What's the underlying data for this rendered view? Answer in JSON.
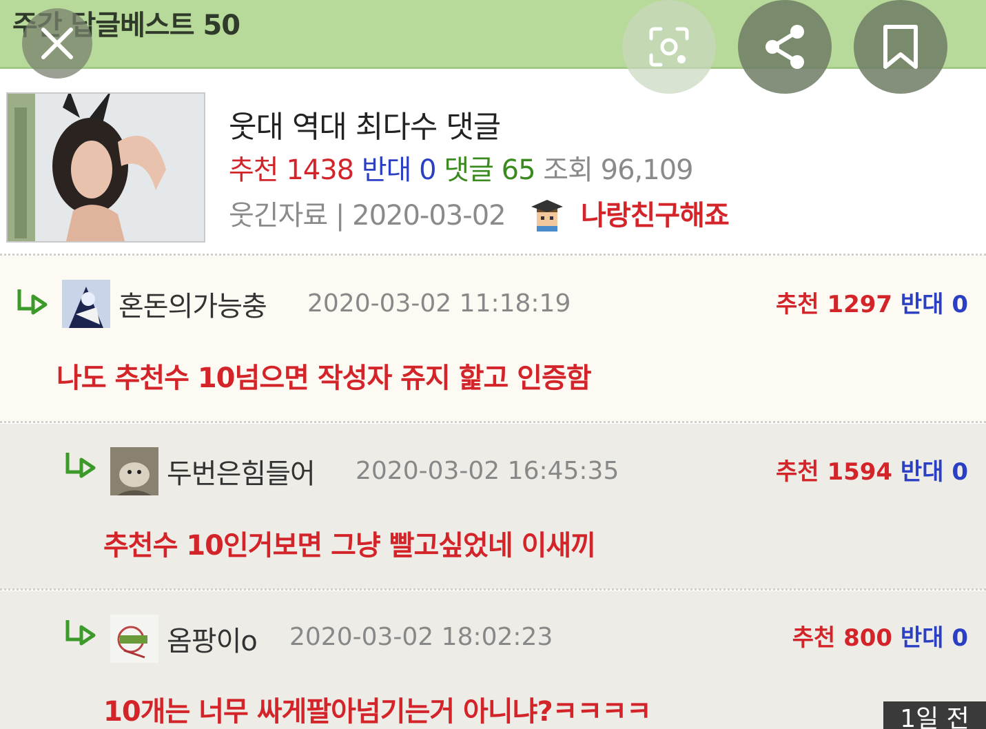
{
  "header": {
    "title": "주간 답글베스트 50"
  },
  "actions": {
    "close_icon": "close-icon",
    "lens_icon": "lens-icon",
    "share_icon": "share-icon",
    "bookmark_icon": "bookmark-icon"
  },
  "post": {
    "title": "웃대 역대 최다수 댓글",
    "stats": {
      "recommend_label": "추천",
      "recommend_value": "1438",
      "oppose_label": "반대",
      "oppose_value": "0",
      "comments_label": "댓글",
      "comments_value": "65",
      "views_label": "조회",
      "views_value": "96,109"
    },
    "category": "웃긴자료",
    "separator": "|",
    "date": "2020-03-02",
    "author": "나랑친구해죠"
  },
  "comments": [
    {
      "name": "혼돈의가능충",
      "time": "2020-03-02 11:18:19",
      "recommend_label": "추천",
      "recommend_value": "1297",
      "oppose_label": "반대",
      "oppose_value": "0",
      "text": "나도 추천수 10넘으면 작성자 쥬지 핥고 인증함"
    },
    {
      "name": "두번은힘들어",
      "time": "2020-03-02 16:45:35",
      "recommend_label": "추천",
      "recommend_value": "1594",
      "oppose_label": "반대",
      "oppose_value": "0",
      "text": "추천수 10인거보면 그냥 빨고싶었네 이새끼"
    },
    {
      "name": "옴팡이o",
      "time": "2020-03-02 18:02:23",
      "recommend_label": "추천",
      "recommend_value": "800",
      "oppose_label": "반대",
      "oppose_value": "0",
      "text": "10개는 너무 싸게팔아넘기는거 아니냐?ㅋㅋㅋㅋ"
    }
  ],
  "badge": {
    "time_ago": "1일 전"
  },
  "colors": {
    "header_bg": "#b7d99a",
    "recommend": "#d3242a",
    "oppose": "#2a3fc4",
    "comments": "#3b8a1f"
  }
}
